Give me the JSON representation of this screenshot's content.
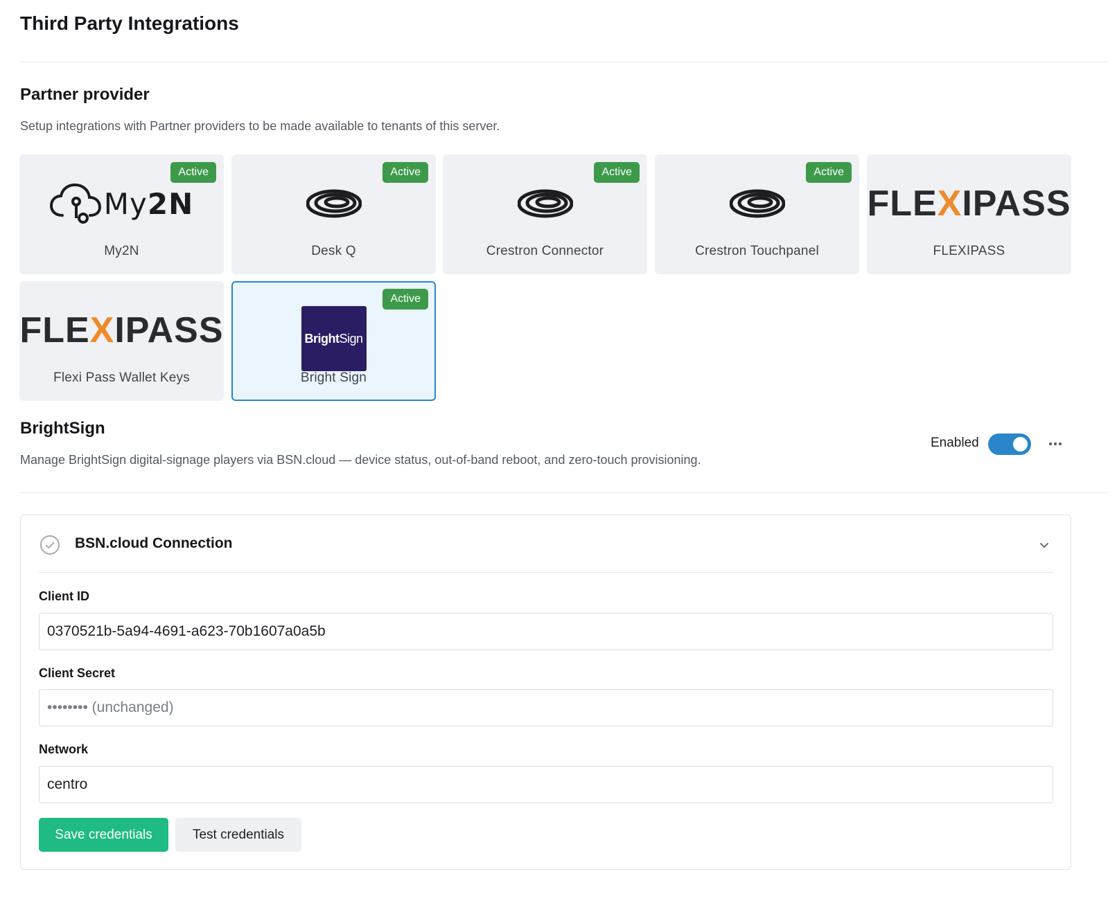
{
  "page": {
    "title": "Third Party Integrations"
  },
  "partner_section": {
    "title": "Partner provider",
    "description": "Setup integrations with Partner providers to be made available to tenants of this server.",
    "badge_label": "Active",
    "cards": [
      {
        "label": "My2N",
        "logo": "my2n-logo",
        "active": true
      },
      {
        "label": "Desk Q",
        "logo": "crestron-swirl-logo",
        "active": true
      },
      {
        "label": "Crestron Connector",
        "logo": "crestron-swirl-logo",
        "active": true
      },
      {
        "label": "Crestron Touchpanel",
        "logo": "crestron-swirl-logo",
        "active": true
      },
      {
        "label": "FLEXIPASS",
        "logo": "flexipass-logo",
        "active": false
      },
      {
        "label": "Flexi Pass Wallet Keys",
        "logo": "flexipass-logo",
        "active": false
      },
      {
        "label": "Bright Sign",
        "logo": "brightsign-logo",
        "active": true,
        "selected": true
      }
    ],
    "logo_text": {
      "my2n_prefix": "My",
      "my2n_suffix": "2N",
      "flexi_a": "FLE",
      "flexi_x": "X",
      "flexi_b": "IPASS",
      "brightsign_bold": "Bright",
      "brightsign_light": "Sign"
    }
  },
  "detail": {
    "title": "BrightSign",
    "description": "Manage BrightSign digital-signage players via BSN.cloud — device status, out-of-band reboot, and zero-touch provisioning.",
    "enabled_label": "Enabled",
    "enabled": true,
    "more_icon": "more-horizontal-icon"
  },
  "connection_panel": {
    "title": "BSN.cloud Connection",
    "fields": {
      "client_id": {
        "label": "Client ID",
        "value": "0370521b-5a94-4691-a623-70b1607a0a5b"
      },
      "client_secret": {
        "label": "Client Secret",
        "placeholder": "•••••••• (unchanged)"
      },
      "network": {
        "label": "Network",
        "value": "centro"
      }
    },
    "save_label": "Save credentials",
    "test_label": "Test credentials"
  },
  "colors": {
    "active_badge": "#3d9a4a",
    "accent_blue": "#2a86c9",
    "save_green": "#1fbb82",
    "flexi_orange": "#ef8a2b",
    "brightsign_purple": "#2b1d63"
  }
}
